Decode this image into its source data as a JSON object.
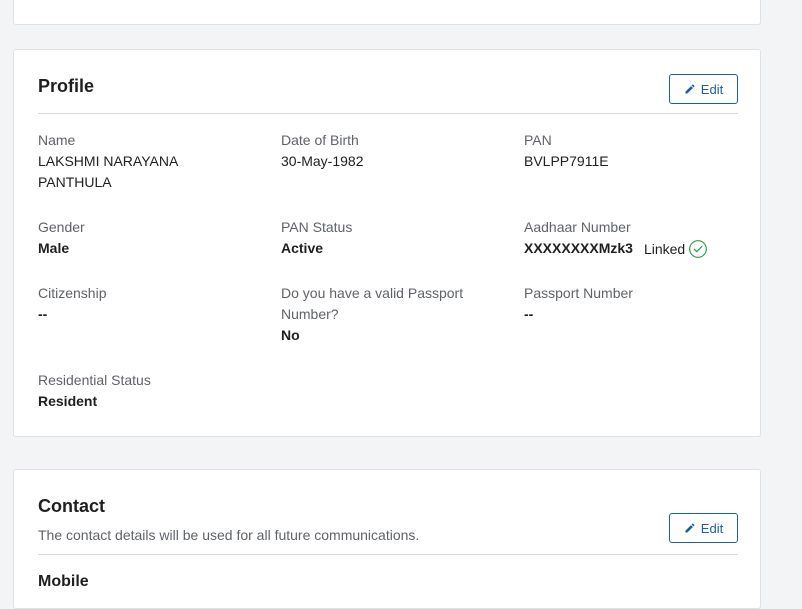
{
  "profile": {
    "title": "Profile",
    "edit_label": "Edit",
    "fields": {
      "name": {
        "label": "Name",
        "value": "LAKSHMI NARAYANA PANTHULA"
      },
      "dob": {
        "label": "Date of Birth",
        "value": "30-May-1982"
      },
      "pan": {
        "label": "PAN",
        "value": "BVLPP7911E"
      },
      "gender": {
        "label": "Gender",
        "value": "Male"
      },
      "pan_status": {
        "label": "PAN Status",
        "value": "Active"
      },
      "aadhaar": {
        "label": "Aadhaar Number",
        "value": "XXXXXXXXMzk3",
        "status": "Linked"
      },
      "citizenship": {
        "label": "Citizenship",
        "value": "--"
      },
      "passport_q": {
        "label": "Do you have a valid Passport Number?",
        "value": "No"
      },
      "passport_number": {
        "label": "Passport Number",
        "value": "--"
      },
      "residential_status": {
        "label": "Residential Status",
        "value": "Resident"
      }
    }
  },
  "contact": {
    "title": "Contact",
    "subtitle": "The contact details will be used for all future communications.",
    "edit_label": "Edit",
    "mobile_heading": "Mobile"
  },
  "colors": {
    "accent": "#1a5fa8",
    "success": "#2e9d4a"
  },
  "icons": {
    "edit": "pencil-icon",
    "linked": "check-circle-icon"
  }
}
